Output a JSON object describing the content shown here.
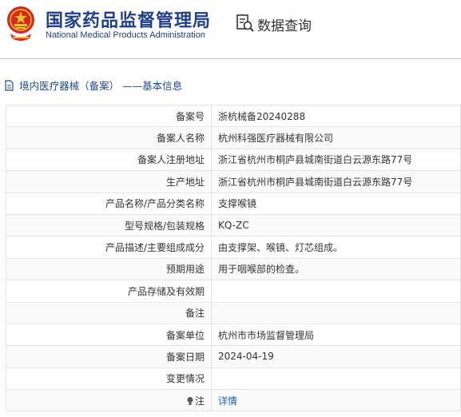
{
  "header": {
    "title_cn": "国家药品监督管理局",
    "title_en": "National Medical Products Administration",
    "query_label": "数据查询"
  },
  "section": {
    "title": "境内医疗器械（备案） ——基本信息"
  },
  "colors": {
    "brand_blue": "#1f3f8a",
    "emblem_red": "#d42a1e",
    "emblem_gold": "#f2c230",
    "link": "#1b5fb0"
  },
  "rows": [
    {
      "key": "备案号",
      "value": "浙杭械备20240288"
    },
    {
      "key": "备案人名称",
      "value": "杭州科强医疗器械有限公司"
    },
    {
      "key": "备案人注册地址",
      "value": "浙江省杭州市桐庐县城南街道白云源东路77号"
    },
    {
      "key": "生产地址",
      "value": "浙江省杭州市桐庐县城南街道白云源东路77号"
    },
    {
      "key": "产品名称/产品分类名称",
      "value": "支撑喉镜"
    },
    {
      "key": "型号规格/包装规格",
      "value": "KQ-ZC"
    },
    {
      "key": "产品描述/主要组成成分",
      "value": "由支撑架、喉镜、灯芯组成。"
    },
    {
      "key": "预期用途",
      "value": "用于咽喉部的检查。"
    },
    {
      "key": "产品存储及有效期",
      "value": ""
    },
    {
      "key": "备注",
      "value": ""
    },
    {
      "key": "备案单位",
      "value": "杭州市市场监督管理局"
    },
    {
      "key": "备案日期",
      "value": "2024-04-19"
    },
    {
      "key": "变更情况",
      "value": ""
    },
    {
      "key": "注",
      "value": "详情",
      "icon": "note-icon"
    }
  ]
}
